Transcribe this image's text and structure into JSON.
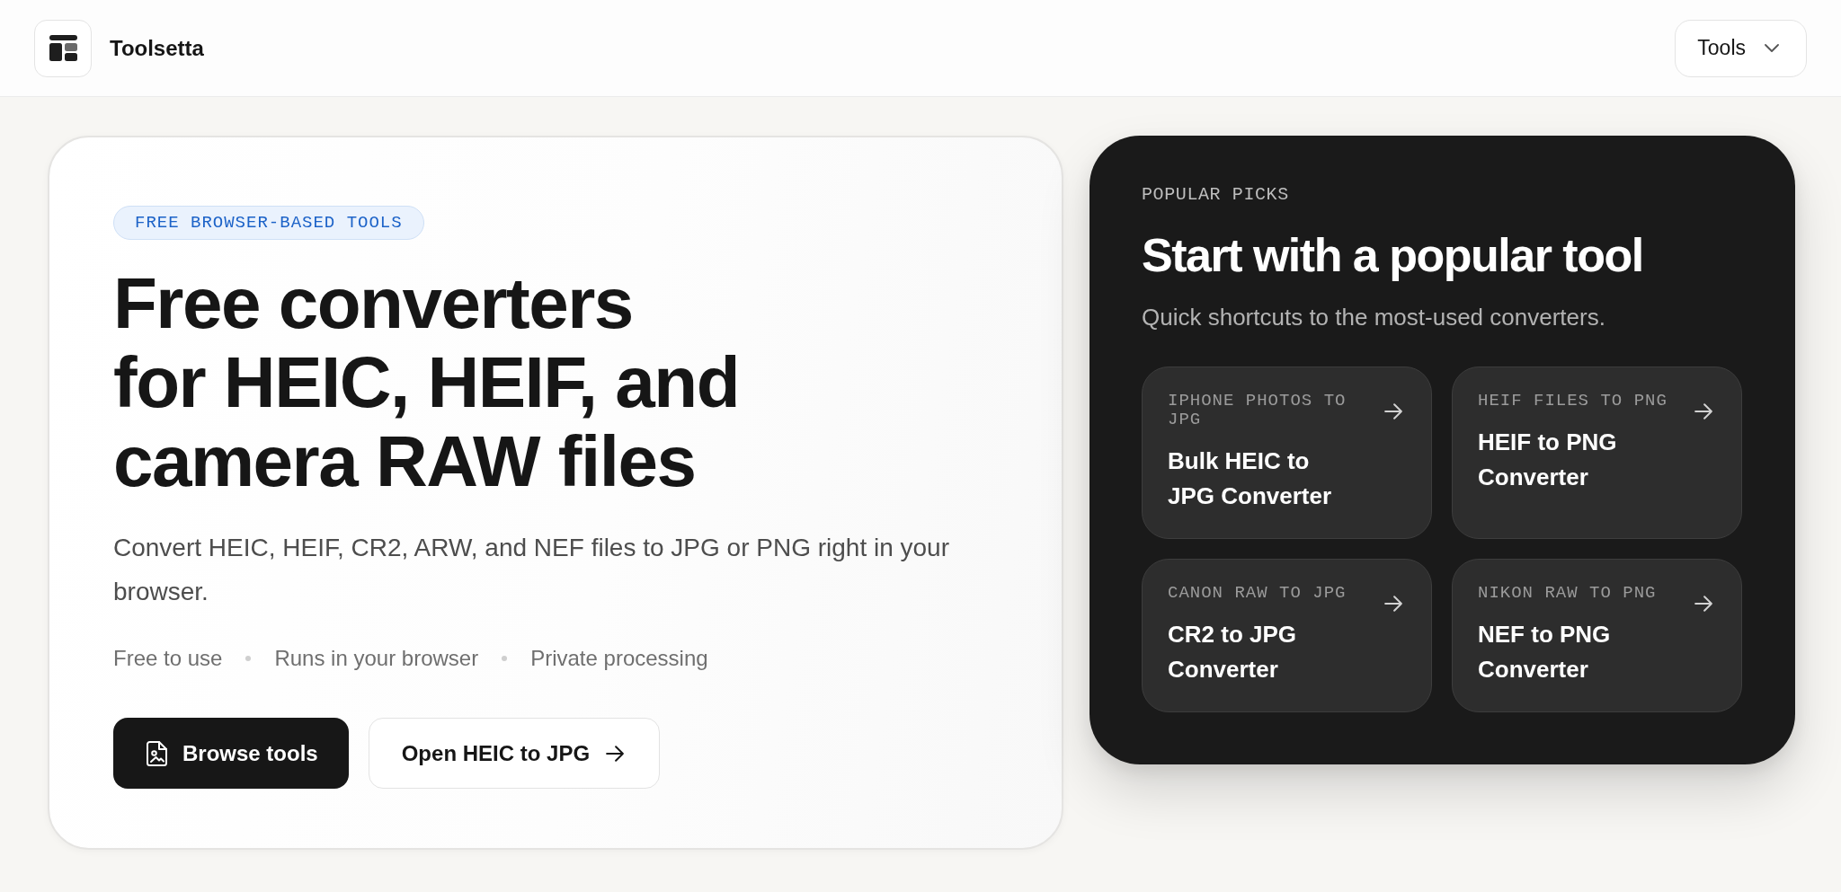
{
  "header": {
    "brand": "Toolsetta",
    "menu_button": {
      "label": "Tools"
    }
  },
  "hero": {
    "badge": "FREE BROWSER-BASED TOOLS",
    "headline": "Free converters\nfor HEIC, HEIF, and\ncamera RAW files",
    "description": "Convert HEIC, HEIF, CR2, ARW, and NEF files to JPG or PNG right in your browser.",
    "features": [
      "Free to use",
      "Runs in your browser",
      "Private processing"
    ],
    "buttons": [
      {
        "label": "Browse tools",
        "kind": "primary"
      },
      {
        "label": "Open HEIC to JPG",
        "kind": "secondary"
      }
    ]
  },
  "popular": {
    "eyebrow": "POPULAR PICKS",
    "title": "Start with a popular tool",
    "subtitle": "Quick shortcuts to the most-used converters.",
    "tools": [
      {
        "tag": "IPHONE PHOTOS TO JPG",
        "title": "Bulk HEIC to JPG Converter"
      },
      {
        "tag": "HEIF FILES TO PNG",
        "title": "HEIF to PNG Converter"
      },
      {
        "tag": "CANON RAW TO JPG",
        "title": "CR2 to JPG Converter"
      },
      {
        "tag": "NIKON RAW TO PNG",
        "title": "NEF to PNG Converter"
      }
    ]
  }
}
